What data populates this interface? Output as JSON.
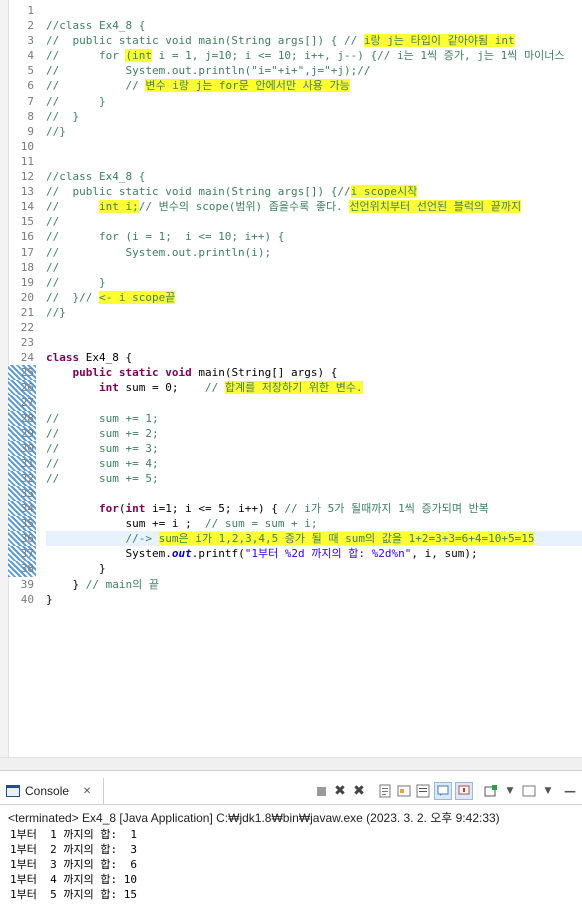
{
  "line_numbers": [
    "1",
    "2",
    "3",
    "4",
    "5",
    "6",
    "7",
    "8",
    "9",
    "10",
    "11",
    "12",
    "13",
    "14",
    "15",
    "16",
    "17",
    "18",
    "19",
    "20",
    "21",
    "22",
    "23",
    "24",
    "25",
    "26",
    "27",
    "28",
    "29",
    "30",
    "31",
    "32",
    "33",
    "34",
    "35",
    "36",
    "37",
    "38",
    "39",
    "40"
  ],
  "code": {
    "l2": "//class Ex4_8 {",
    "l3a": "//  public static void main(String args[]) { // ",
    "l3b": "i랑 j는 타입이 같아야됨 int",
    "l4a": "//      for ",
    "l4b": "(int",
    "l4c": " i = 1, j=10; i <= 10; i++, j--) {// i는 1씩 증가, j는 1씩 마이너스",
    "l5": "//          System.out.println(\"i=\"+i+\",j=\"+j);//",
    "l6a": "//          // ",
    "l6b": "변수 i랑 j는 for문 안에서만 사용 가능",
    "l7": "//      }",
    "l8": "//  }",
    "l9": "//}",
    "l12": "//class Ex4_8 {",
    "l13a": "//  public static void main(String args[]) {//",
    "l13b": "i scope시작",
    "l14a": "//      ",
    "l14b": "int i;",
    "l14c": "// 변수의 scope(범위) 좁을수록 좋다. ",
    "l14d": "선언위치부터 선언된 블럭의 끝까지",
    "l15": "//",
    "l16": "//      for (i = 1;  i <= 10; i++) {",
    "l17": "//          System.out.println(i);",
    "l18": "//",
    "l19": "//      }",
    "l20a": "//  }// ",
    "l20b": "<- i scope끝",
    "l21": "//}",
    "l24a": "class",
    "l24b": " Ex4_8 {",
    "l25a": "public static void",
    "l25b": " main(String[] args) {",
    "l26a": "int",
    "l26b": " sum = 0;    ",
    "l26c": "// ",
    "l26d": "합계를 저장하기 위한 변수.",
    "l28": "//      sum += 1;",
    "l29": "//      sum += 2;",
    "l30": "//      sum += 3;",
    "l31": "//      sum += 4;",
    "l32": "//      sum += 5;",
    "l34a": "for",
    "l34b": "(",
    "l34c": "int",
    "l34d": " i=1; i <= 5; i++) { ",
    "l34e": "// i가 5가 될때까지 1씩 증가되며 반복",
    "l35a": "sum += i ;  ",
    "l35b": "// sum = sum + i;",
    "l36a": "//-> ",
    "l36b": "sum은 i가 1,2,3,4,5 증가 될 때 sum의 값을 1+2=3+3=6+4=10+5=15",
    "l37a": "System.",
    "l37b": "out",
    "l37c": ".printf(",
    "l37d": "\"1부터 %2d 까지의 합: %2d%n\"",
    "l37e": ", i, sum);",
    "l38": "}",
    "l39a": "} ",
    "l39b": "// main의 끝",
    "l40": "}"
  },
  "console": {
    "tab_label": "Console",
    "terminated": "<terminated> Ex4_8 [Java Application] C:₩jdk1.8₩bin₩javaw.exe (2023. 3. 2. 오후 9:42:33)",
    "output": [
      "1부터  1 까지의 합:  1",
      "1부터  2 까지의 합:  3",
      "1부터  3 까지의 합:  6",
      "1부터  4 까지의 합: 10",
      "1부터  5 까지의 합: 15"
    ]
  },
  "colors": {
    "keyword": "#7f0055",
    "comment": "#3f7f5f",
    "string": "#2a00ff",
    "field": "#0000c0",
    "highlight": "#ffff33"
  },
  "icons": [
    "console-icon",
    "close-icon",
    "terminate-icon",
    "remove-launches-icon",
    "clear-console-icon",
    "scroll-lock-icon",
    "show-on-output-icon",
    "show-on-error-icon",
    "pin-console-icon",
    "open-console-icon",
    "display-selected-icon",
    "minimize-icon",
    "maximize-icon"
  ]
}
